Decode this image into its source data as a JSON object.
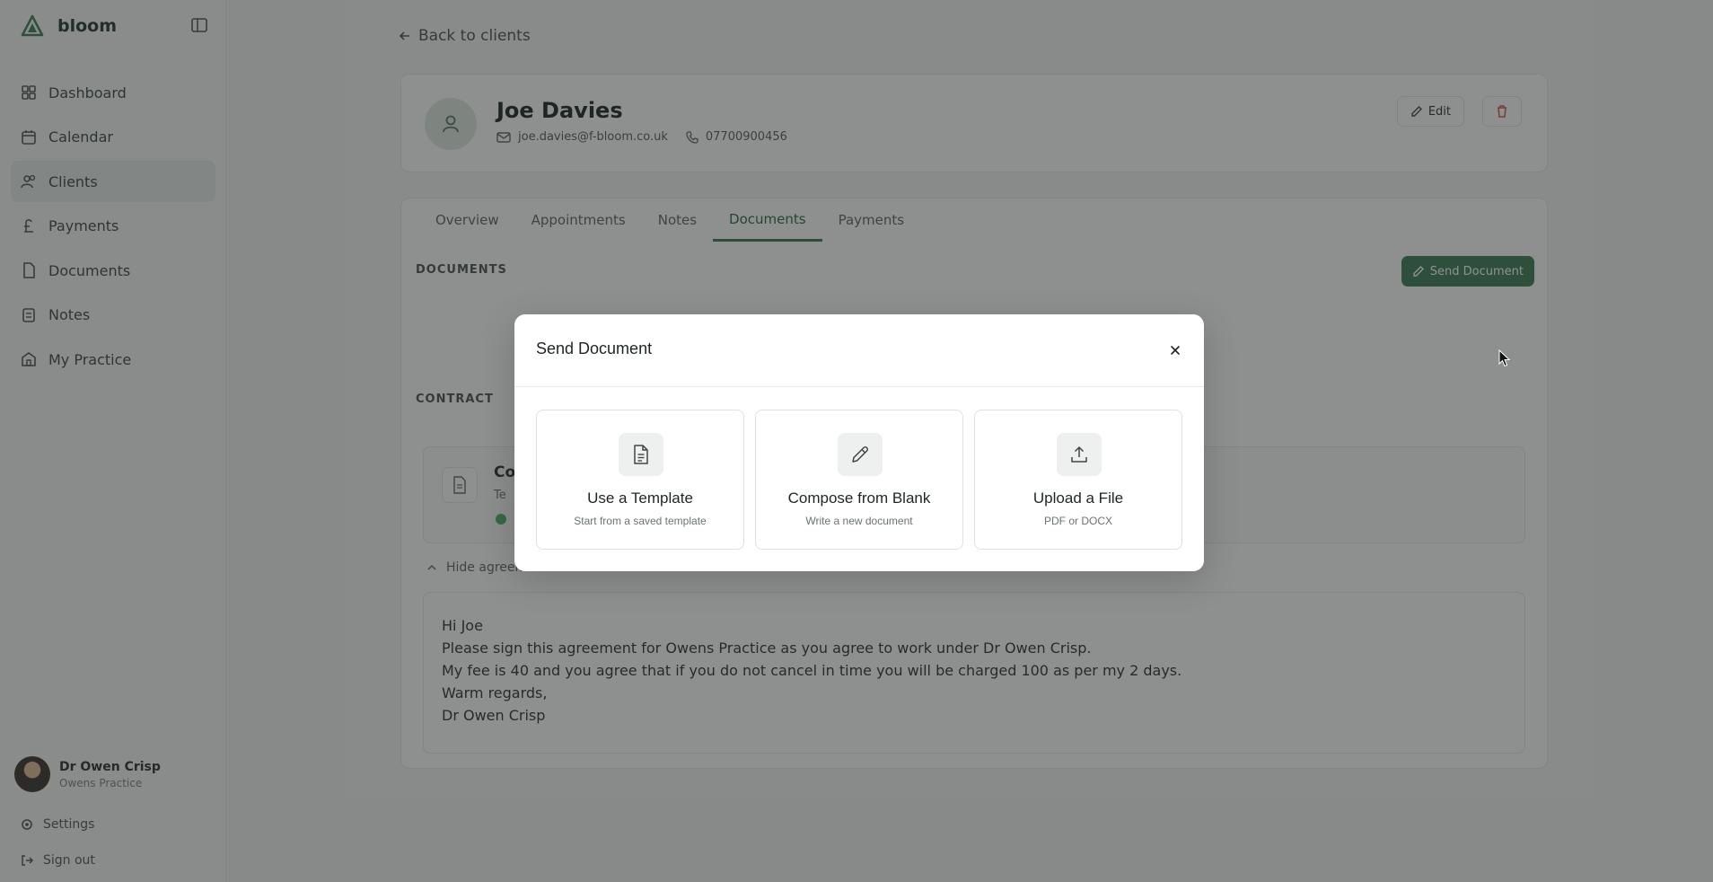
{
  "brand": {
    "name": "bloom"
  },
  "sidebar": {
    "items": [
      {
        "label": "Dashboard",
        "icon": "grid-icon"
      },
      {
        "label": "Calendar",
        "icon": "calendar-icon"
      },
      {
        "label": "Clients",
        "icon": "users-icon",
        "active": true
      },
      {
        "label": "Payments",
        "icon": "pound-icon"
      },
      {
        "label": "Documents",
        "icon": "file-icon"
      },
      {
        "label": "Notes",
        "icon": "note-icon"
      },
      {
        "label": "My Practice",
        "icon": "building-icon"
      }
    ],
    "user": {
      "name": "Dr Owen Crisp",
      "role": "Owens Practice"
    },
    "settings_label": "Settings",
    "signout_label": "Sign out"
  },
  "main": {
    "back_label": "Back to clients",
    "client": {
      "name": "Joe Davies",
      "email": "joe.davies@f-bloom.co.uk",
      "phone": "07700900456",
      "edit_label": "Edit"
    },
    "tabs": [
      {
        "label": "Overview"
      },
      {
        "label": "Appointments"
      },
      {
        "label": "Notes"
      },
      {
        "label": "Documents",
        "active": true
      },
      {
        "label": "Payments"
      }
    ],
    "documents_heading": "DOCUMENTS",
    "send_document_label": "Send Document",
    "contract_heading": "CONTRACT",
    "contract": {
      "title": "Co",
      "subtitle": "Te"
    },
    "hide_label": "Hide agreement",
    "agreement_lines": [
      "Hi Joe",
      "Please sign this agreement for Owens Practice as you agree to work under Dr Owen Crisp.",
      "My fee is 40 and you agree that if you do not cancel in time you will be charged 100 as per my 2 days.",
      "Warm regards,",
      "Dr Owen Crisp"
    ]
  },
  "modal": {
    "title": "Send Document",
    "options": [
      {
        "title": "Use a Template",
        "desc": "Start from a saved template",
        "icon": "document-icon"
      },
      {
        "title": "Compose from Blank",
        "desc": "Write a new document",
        "icon": "pencil-icon"
      },
      {
        "title": "Upload a File",
        "desc": "PDF or DOCX",
        "icon": "upload-icon"
      }
    ]
  },
  "colors": {
    "accent": "#3e7d57",
    "overlay": "#1e211f",
    "danger": "#d9534f"
  }
}
